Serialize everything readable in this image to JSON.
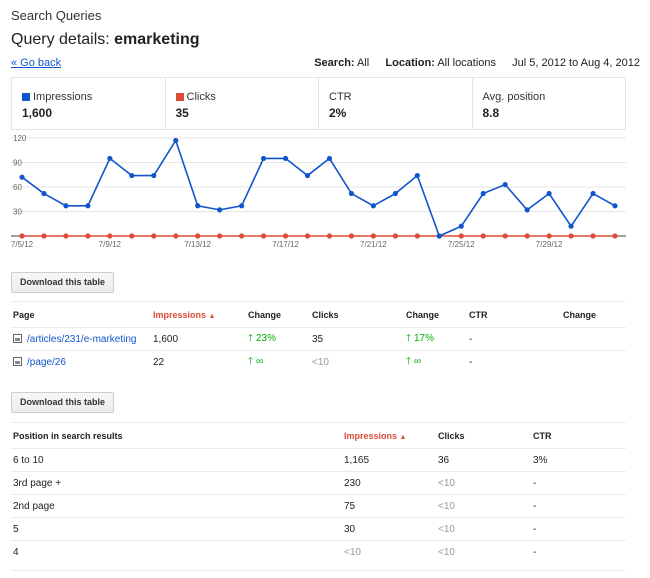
{
  "header": {
    "breadcrumb": "Search Queries",
    "title_prefix": "Query details: ",
    "query": "emarketing",
    "go_back": "« Go back"
  },
  "filters": {
    "search_label": "Search:",
    "search_value": "All",
    "location_label": "Location:",
    "location_value": "All locations",
    "date_range": "Jul 5, 2012 to Aug 4, 2012"
  },
  "metrics": [
    {
      "label": "Impressions",
      "value": "1,600",
      "color": "#1155cc"
    },
    {
      "label": "Clicks",
      "value": "35",
      "color": "#dd4b39"
    },
    {
      "label": "CTR",
      "value": "2%"
    },
    {
      "label": "Avg. position",
      "value": "8.8"
    }
  ],
  "chart_data": {
    "type": "line",
    "ylim": [
      0,
      120
    ],
    "yticks": [
      30,
      60,
      90,
      120
    ],
    "x_tick_labels": [
      "7/5/12",
      "7/9/12",
      "7/13/12",
      "7/17/12",
      "7/21/12",
      "7/25/12",
      "7/29/12"
    ],
    "x_tick_indices": [
      0,
      4,
      8,
      12,
      16,
      20,
      24
    ],
    "series": [
      {
        "name": "Impressions",
        "color": "#1155cc",
        "values": [
          72,
          52,
          37,
          37,
          95,
          74,
          74,
          117,
          37,
          32,
          37,
          95,
          95,
          74,
          95,
          52,
          37,
          52,
          74,
          0,
          12,
          52,
          63,
          32,
          52,
          12,
          52,
          37
        ]
      },
      {
        "name": "Clicks",
        "color": "#dd4b39",
        "values": [
          0,
          0,
          0,
          0,
          0,
          0,
          0,
          0,
          0,
          0,
          0,
          0,
          0,
          0,
          0,
          0,
          0,
          0,
          0,
          0,
          0,
          0,
          0,
          0,
          0,
          0,
          0,
          0
        ]
      }
    ]
  },
  "download_label": "Download this table",
  "pages_table": {
    "headers": [
      "Page",
      "Impressions",
      "Change",
      "Clicks",
      "Change",
      "CTR",
      "Change"
    ],
    "sort_arrow": "▲",
    "rows": [
      {
        "page": "/articles/231/e-marketing",
        "impressions": "1,600",
        "impr_change": "23%",
        "clicks": "35",
        "clicks_change": "17%",
        "ctr": "-",
        "ctr_change": ""
      },
      {
        "page": "/page/26",
        "impressions": "22",
        "impr_change": "∞",
        "clicks": "<10",
        "clicks_change": "∞",
        "ctr": "-",
        "ctr_change": ""
      }
    ],
    "up_arrow": "➜"
  },
  "position_table": {
    "headers": [
      "Position in search results",
      "Impressions",
      "Clicks",
      "CTR"
    ],
    "rows": [
      {
        "position": "6 to 10",
        "impressions": "1,165",
        "clicks": "36",
        "ctr": "3%"
      },
      {
        "position": "3rd page +",
        "impressions": "230",
        "clicks": "<10",
        "ctr": "-"
      },
      {
        "position": "2nd page",
        "impressions": "75",
        "clicks": "<10",
        "ctr": "-"
      },
      {
        "position": "5",
        "impressions": "30",
        "clicks": "<10",
        "ctr": "-"
      },
      {
        "position": "4",
        "impressions": "<10",
        "clicks": "<10",
        "ctr": "-"
      }
    ]
  }
}
